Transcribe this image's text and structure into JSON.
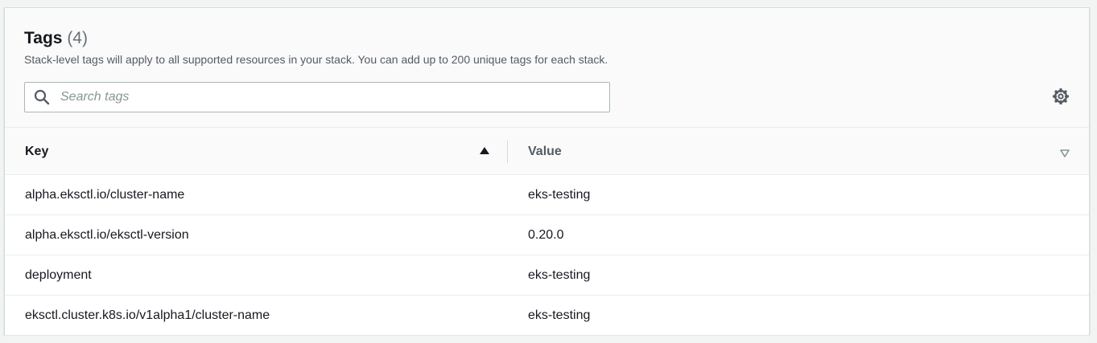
{
  "tags_panel": {
    "title": "Tags",
    "count": "(4)",
    "description": "Stack-level tags will apply to all supported resources in your stack. You can add up to 200 unique tags for each stack.",
    "search": {
      "placeholder": "Search tags",
      "value": ""
    },
    "icons": {
      "search": "search-icon",
      "settings": "gear-icon",
      "sort_asc": "sort-ascending-icon",
      "sort": "sort-icon"
    }
  },
  "table": {
    "columns": [
      {
        "label": "Key"
      },
      {
        "label": "Value"
      }
    ],
    "rows": [
      {
        "key": "alpha.eksctl.io/cluster-name",
        "value": "eks-testing"
      },
      {
        "key": "alpha.eksctl.io/eksctl-version",
        "value": "0.20.0"
      },
      {
        "key": "deployment",
        "value": "eks-testing"
      },
      {
        "key": "eksctl.cluster.k8s.io/v1alpha1/cluster-name",
        "value": "eks-testing"
      }
    ]
  },
  "colors": {
    "background": "#f2f3f3",
    "panel": "#fafafa",
    "text": "#16191f",
    "muted": "#545b64",
    "border": "#eaeded"
  }
}
